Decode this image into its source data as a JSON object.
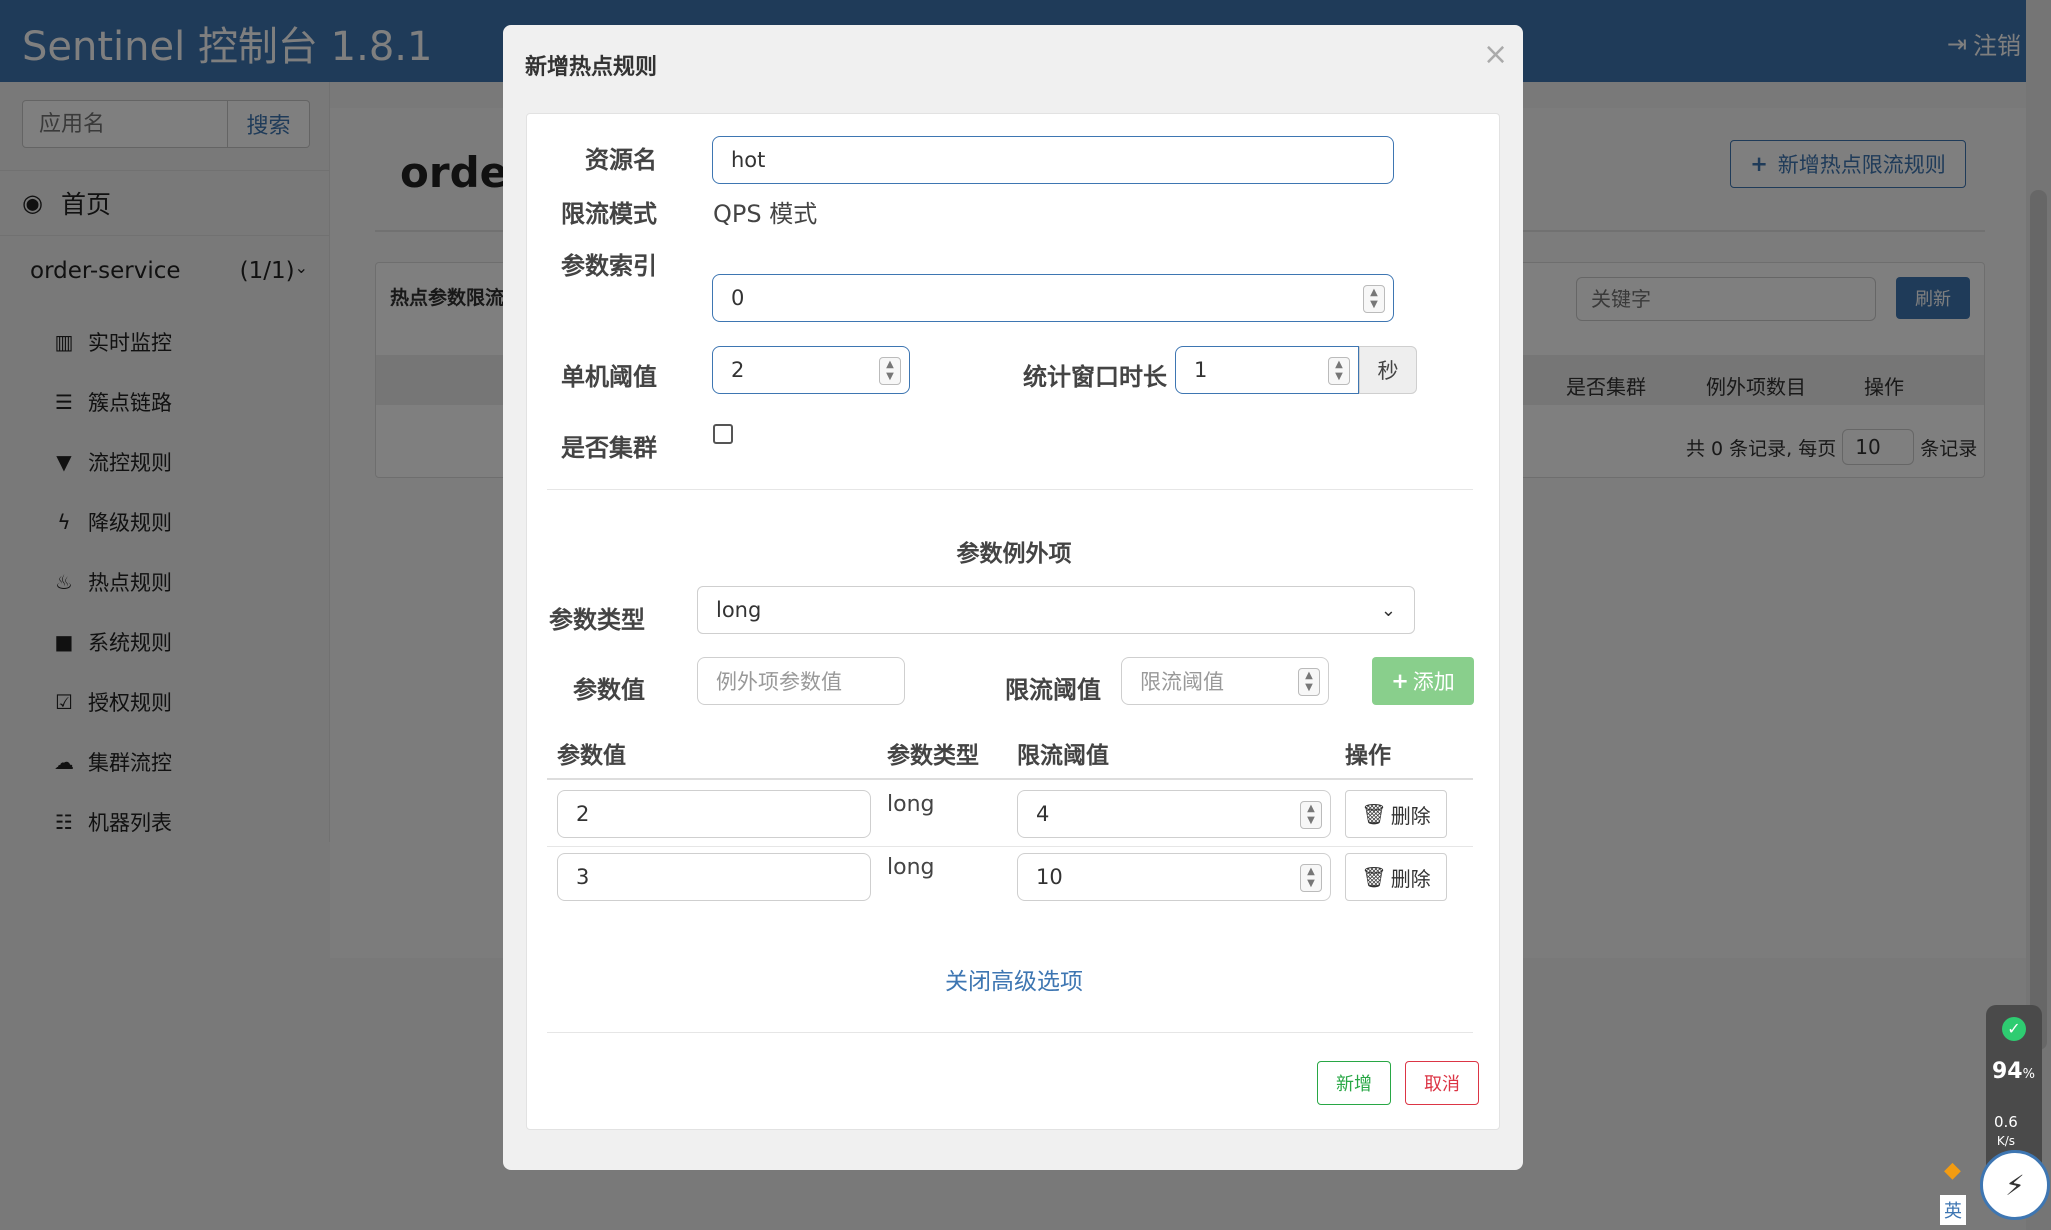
{
  "app": {
    "brand": "Sentinel 控制台 1.8.1",
    "logout": "注销"
  },
  "sidebar": {
    "search_placeholder": "应用名",
    "search_button": "搜索",
    "home": "首页",
    "app_name": "order-service",
    "app_count": "(1/1)",
    "items": [
      {
        "label": "实时监控",
        "icon": "bar-chart-icon"
      },
      {
        "label": "簇点链路",
        "icon": "list-icon"
      },
      {
        "label": "流控规则",
        "icon": "filter-icon"
      },
      {
        "label": "降级规则",
        "icon": "bolt-icon"
      },
      {
        "label": "热点规则",
        "icon": "fire-icon"
      },
      {
        "label": "系统规则",
        "icon": "lock-icon"
      },
      {
        "label": "授权规则",
        "icon": "check-icon"
      },
      {
        "label": "集群流控",
        "icon": "cloud-icon"
      },
      {
        "label": "机器列表",
        "icon": "table-list-icon"
      }
    ]
  },
  "content": {
    "title": "order",
    "add_button": "新增热点限流规则",
    "panel_title": "热点参数限流",
    "keyword_placeholder": "关键字",
    "refresh": "刷新",
    "columns": [
      "是否集群",
      "例外项数目",
      "操作"
    ],
    "pager": {
      "prefix": "共 0 条记录, 每页",
      "page_size": "10",
      "suffix": "条记录"
    }
  },
  "modal": {
    "title": "新增热点规则",
    "close": "×",
    "resource_label": "资源名",
    "resource_value": "hot",
    "mode_label": "限流模式",
    "mode_value": "QPS 模式",
    "param_index_label": "参数索引",
    "param_index_value": "0",
    "threshold_label": "单机阈值",
    "threshold_value": "2",
    "window_label": "统计窗口时长",
    "window_value": "1",
    "window_unit": "秒",
    "cluster_label": "是否集群",
    "exceptions_title": "参数例外项",
    "param_type_label": "参数类型",
    "param_type_value": "long",
    "param_value_label": "参数值",
    "param_value_placeholder": "例外项参数值",
    "limit_label": "限流阈值",
    "limit_placeholder": "限流阈值",
    "add_button": "添加",
    "table_headers": [
      "参数值",
      "参数类型",
      "限流阈值",
      "操作"
    ],
    "rows": [
      {
        "value": "2",
        "type": "long",
        "limit": "4",
        "action": "删除"
      },
      {
        "value": "3",
        "type": "long",
        "limit": "10",
        "action": "删除"
      }
    ],
    "toggle_advanced": "关闭高级选项",
    "save": "新增",
    "cancel": "取消"
  },
  "widget": {
    "percent": "94",
    "percent_unit": "%",
    "speed": "0.6",
    "speed_unit": "K/s",
    "lang": "英"
  }
}
